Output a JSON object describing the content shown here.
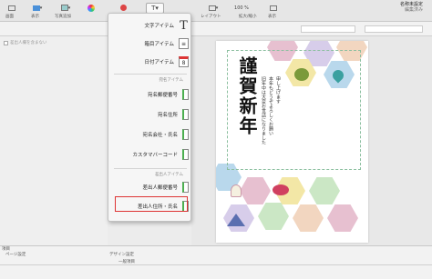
{
  "toolbar": {
    "items": [
      {
        "label": "画面",
        "icon": "view-icon"
      },
      {
        "label": "表示",
        "icon": "display-icon"
      },
      {
        "label": "写真追加",
        "icon": "photo-add-icon"
      },
      {
        "label": "",
        "icon": "color-icon"
      },
      {
        "label": "",
        "icon": "stamp-icon"
      },
      {
        "label": "T",
        "icon": "text-icon"
      },
      {
        "label": "レイアウト",
        "icon": "layout-icon"
      },
      {
        "label": "拡大/縮小",
        "icon": "zoom-icon"
      },
      {
        "label": "表示",
        "icon": "show-icon"
      }
    ],
    "doc_title": "名称未設定",
    "doc_subtitle": "編集済み",
    "zoom": "100 %"
  },
  "left_panel": {
    "check_label_1": "差出人欄を含まない",
    "check_label_2": "差出人欄を含まない"
  },
  "menu": {
    "items": [
      {
        "label": "文字アイテム",
        "icon": "T"
      },
      {
        "label": "箱目アイテム",
        "icon": "≡"
      },
      {
        "label": "日付アイテム",
        "icon": "8"
      },
      {
        "label": "宛名郵便番号",
        "icon": ""
      },
      {
        "label": "宛名住所",
        "icon": ""
      },
      {
        "label": "宛名会社・氏名",
        "icon": ""
      },
      {
        "label": "カスタマバーコード",
        "icon": ""
      },
      {
        "label": "差出人郵便番号",
        "icon": ""
      },
      {
        "label": "差出人住所・氏名",
        "icon": ""
      }
    ],
    "section_1": "宛名アイテム",
    "section_2": "差出人アイテム"
  },
  "card": {
    "title": "謹賀新年",
    "lines": [
      "旧年中は大変お世話になりました",
      "本年もどうぞよろしくお願い",
      "申し上げます"
    ]
  },
  "bottom": {
    "left_labels": [
      "デザイン設定",
      "一般項目"
    ],
    "right_labels": [
      "ページ設定",
      "項目"
    ]
  },
  "colors": {
    "accent": "#d33333",
    "hex_colors": [
      "#e7c0d0",
      "#f3e7a6",
      "#b9d8ec",
      "#cbe7c5",
      "#f2d6c0",
      "#d7cdea"
    ]
  }
}
